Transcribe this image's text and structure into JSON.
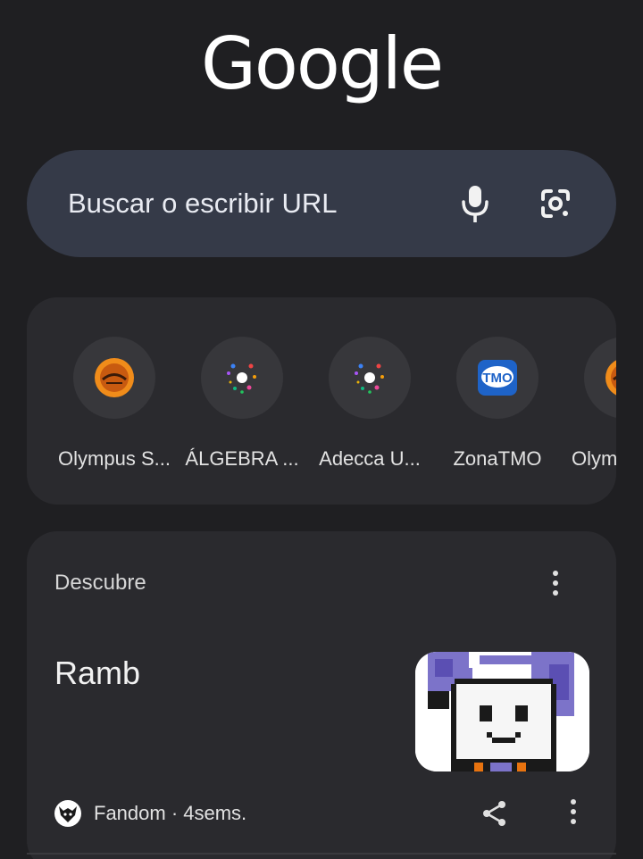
{
  "logo": {
    "text": "Google"
  },
  "search": {
    "placeholder": "Buscar o escribir URL",
    "mic_icon": "microphone-icon",
    "lens_icon": "google-lens-icon"
  },
  "shortcuts": [
    {
      "label": "Olympus S...",
      "icon": "olympus-logo-icon"
    },
    {
      "label": "ÁLGEBRA ...",
      "icon": "sparkle-icon"
    },
    {
      "label": "Adecca U...",
      "icon": "sparkle-icon"
    },
    {
      "label": "ZonaTMO",
      "icon": "tmo-logo-icon",
      "icon_text": "TMO"
    },
    {
      "label": "Olym",
      "icon": "olympus-logo-icon"
    }
  ],
  "discover": {
    "title": "Descubre",
    "menu_icon": "more-vert-icon",
    "article": {
      "title": "Ramb",
      "source": "Fandom · 4sems.",
      "share_icon": "share-icon",
      "menu_icon": "more-vert-icon"
    }
  },
  "colors": {
    "background": "#1f1f22",
    "search_box": "#353a48",
    "card": "#2a2a2e",
    "tile_circle": "#37373b"
  }
}
